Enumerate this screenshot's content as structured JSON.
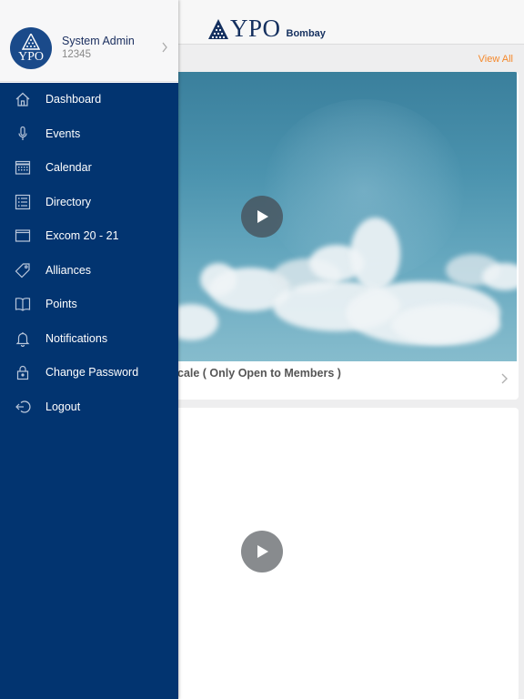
{
  "header": {
    "brand_name": "YPO",
    "brand_sub": "Bombay"
  },
  "feed": {
    "view_all": "View All",
    "card1_title": "cale ( Only Open to Members )"
  },
  "profile": {
    "name": "System Admin",
    "id": "12345",
    "avatar_text": "YPO"
  },
  "menu": {
    "items": [
      {
        "label": "Dashboard",
        "icon": "home-icon"
      },
      {
        "label": "Events",
        "icon": "microphone-icon"
      },
      {
        "label": "Calendar",
        "icon": "calendar-icon"
      },
      {
        "label": "Directory",
        "icon": "list-icon"
      },
      {
        "label": "Excom 20 - 21",
        "icon": "window-icon"
      },
      {
        "label": "Alliances",
        "icon": "tag-icon"
      },
      {
        "label": "Points",
        "icon": "book-icon"
      },
      {
        "label": "Notifications",
        "icon": "bell-icon"
      },
      {
        "label": "Change Password",
        "icon": "lock-icon"
      },
      {
        "label": "Logout",
        "icon": "logout-icon"
      }
    ]
  },
  "colors": {
    "drawer": "#023470",
    "accent": "#f5882a",
    "brand": "#15305f"
  }
}
